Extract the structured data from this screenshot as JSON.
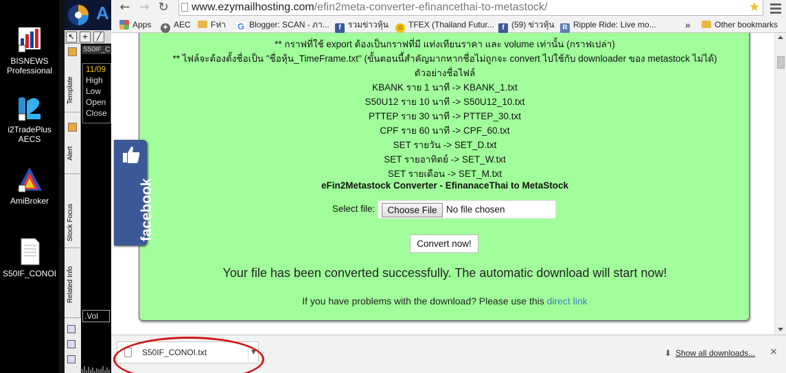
{
  "desktop": {
    "icons": [
      {
        "label1": "BISNEWS",
        "label2": "Professional",
        "icon": "bisnews-icon"
      },
      {
        "label1": "i2TradePlus",
        "label2": "AECS",
        "icon": "i2tradeplus-icon"
      },
      {
        "label1": "AmiBroker",
        "label2": "",
        "icon": "amibroker-icon"
      },
      {
        "label1": "S50IF_CONOI",
        "label2": "",
        "icon": "text-file-icon"
      }
    ]
  },
  "app_panel": {
    "chart_tab": "S50IF_C",
    "ohlc": {
      "date": "11/09",
      "high": "High",
      "low": "Low",
      "open": "Open",
      "close": "Close"
    },
    "vol_label": ".Vol",
    "vertical_tabs": [
      "Template",
      "Alert",
      "Stock Focus",
      "Related Info"
    ]
  },
  "browser": {
    "url_host": "www.ezymailhosting.com",
    "url_path": "/efin2meta-converter-efinancethai-to-metastock/",
    "bookmarks": [
      {
        "label": "Apps",
        "icon": "apps-grid-icon",
        "color": "#d9534f"
      },
      {
        "label": "AEC",
        "icon": "aec-icon",
        "color": "#666666"
      },
      {
        "label": "Fห่า",
        "icon": "folder-icon",
        "color": "#e7b648"
      },
      {
        "label": "Blogger: SCAN - ภา...",
        "icon": "google-icon",
        "color": "#4285f4"
      },
      {
        "label": "รวมข่าวหุ้น",
        "icon": "facebook-icon",
        "color": "#3b5998"
      },
      {
        "label": "TFEX (Thailand Futur...",
        "icon": "smiley-icon",
        "color": "#f2c200"
      },
      {
        "label": "(59) ข่าวหุ้น",
        "icon": "facebook-icon",
        "color": "#3b5998"
      },
      {
        "label": "Ripple Ride: Live mo...",
        "icon": "ripple-icon",
        "color": "#5b7fb5"
      }
    ],
    "bookmarks_overflow": "»",
    "other_bookmarks": "Other bookmarks"
  },
  "page": {
    "lines": [
      "** กราฟที่ใช้ export ต้องเป็นกราฟที่มี แท่งเทียนราคา และ volume เท่านั้น (กราฟเปล่า)",
      "** ไฟล์จะต้องตั้งชื่อเป็น \"ชื่อหุ้น_TimeFrame.txt\" (ขั้นตอนนี้สำคัญมากหากชื่อไม่ถูกจะ convert ไปใช้กับ downloader ของ metastock ไม่ได้)",
      "ตัวอย่างชื่อไฟล์",
      "KBANK ราย 1 นาที -> KBANK_1.txt",
      "S50U12 ราย 10 นาที -> S50U12_10.txt",
      "PTTEP ราย 30 นาที -> PTTEP_30.txt",
      "CPF ราย 60 นาที -> CPF_60.txt",
      "SET รายวัน -> SET_D.txt",
      "SET รายอาทิตย์ -> SET_W.txt",
      "SET รายเดือน -> SET_M.txt"
    ],
    "heading": "eFin2Metastock Converter - EfinanaceThai to MetaStock",
    "select_label": "Select file:",
    "choose_file": "Choose File",
    "no_file": "No file chosen",
    "convert_button": "Convert now!",
    "success_message": "Your file has been converted successfully. The automatic download will start now!",
    "help_text": "If you have problems with the download? Please use this",
    "help_link": "direct link",
    "facebook_label": "facebook"
  },
  "download_bar": {
    "filename": "S50IF_CONOI.txt",
    "show_all": "Show all downloads...",
    "close": "×"
  },
  "colors": {
    "page_green": "#a0ff9a",
    "facebook_blue": "#3b5998",
    "annotation_red": "#d01818",
    "link_blue": "#3f7fb2"
  }
}
